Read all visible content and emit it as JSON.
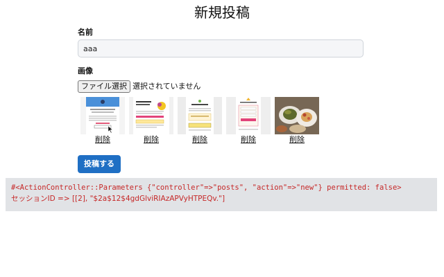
{
  "page": {
    "title": "新規投稿"
  },
  "form": {
    "name_label": "名前",
    "name_value": "aaa",
    "image_label": "画像",
    "file_button_label": "ファイル選択",
    "file_status": "選択されていません",
    "thumbnails": [
      {
        "delete_label": "削除",
        "kind": "screenshot-blue-page"
      },
      {
        "delete_label": "削除",
        "kind": "screenshot-get-started"
      },
      {
        "delete_label": "削除",
        "kind": "screenshot-welcome"
      },
      {
        "delete_label": "削除",
        "kind": "screenshot-signup"
      },
      {
        "delete_label": "削除",
        "kind": "food-photo"
      }
    ],
    "submit_label": "投稿する"
  },
  "debug": {
    "params_line": "#<ActionController::Parameters {\"controller\"=>\"posts\", \"action\"=>\"new\"} permitted: false>",
    "session_line": "セッションID => [[2], \"$2a$12$4gdGlviRIAzAPVyHTPEQv.\"]"
  },
  "colors": {
    "submit_button": "#1f6fc4",
    "debug_text": "#c62828",
    "debug_background": "#e1e3e6"
  }
}
